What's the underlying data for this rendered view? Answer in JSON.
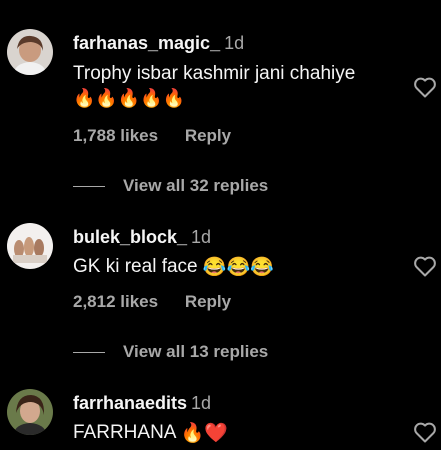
{
  "comments": [
    {
      "username": "farhanas_magic_",
      "time": "1d",
      "text": "Trophy isbar kashmir jani chahiye",
      "emoji_line": "🔥🔥🔥🔥🔥",
      "likes": "1,788 likes",
      "reply_label": "Reply",
      "view_replies": "View all 32 replies"
    },
    {
      "username": "bulek_block_",
      "time": "1d",
      "text": "GK ki real face",
      "emoji_inline": "😂😂😂",
      "likes": "2,812 likes",
      "reply_label": "Reply",
      "view_replies": "View all 13 replies"
    },
    {
      "username": "farrhanaedits",
      "time": "1d",
      "text": "FARRHANA",
      "emoji_inline": "🔥❤️"
    }
  ],
  "icons": {
    "like": "heart-outline-icon"
  }
}
